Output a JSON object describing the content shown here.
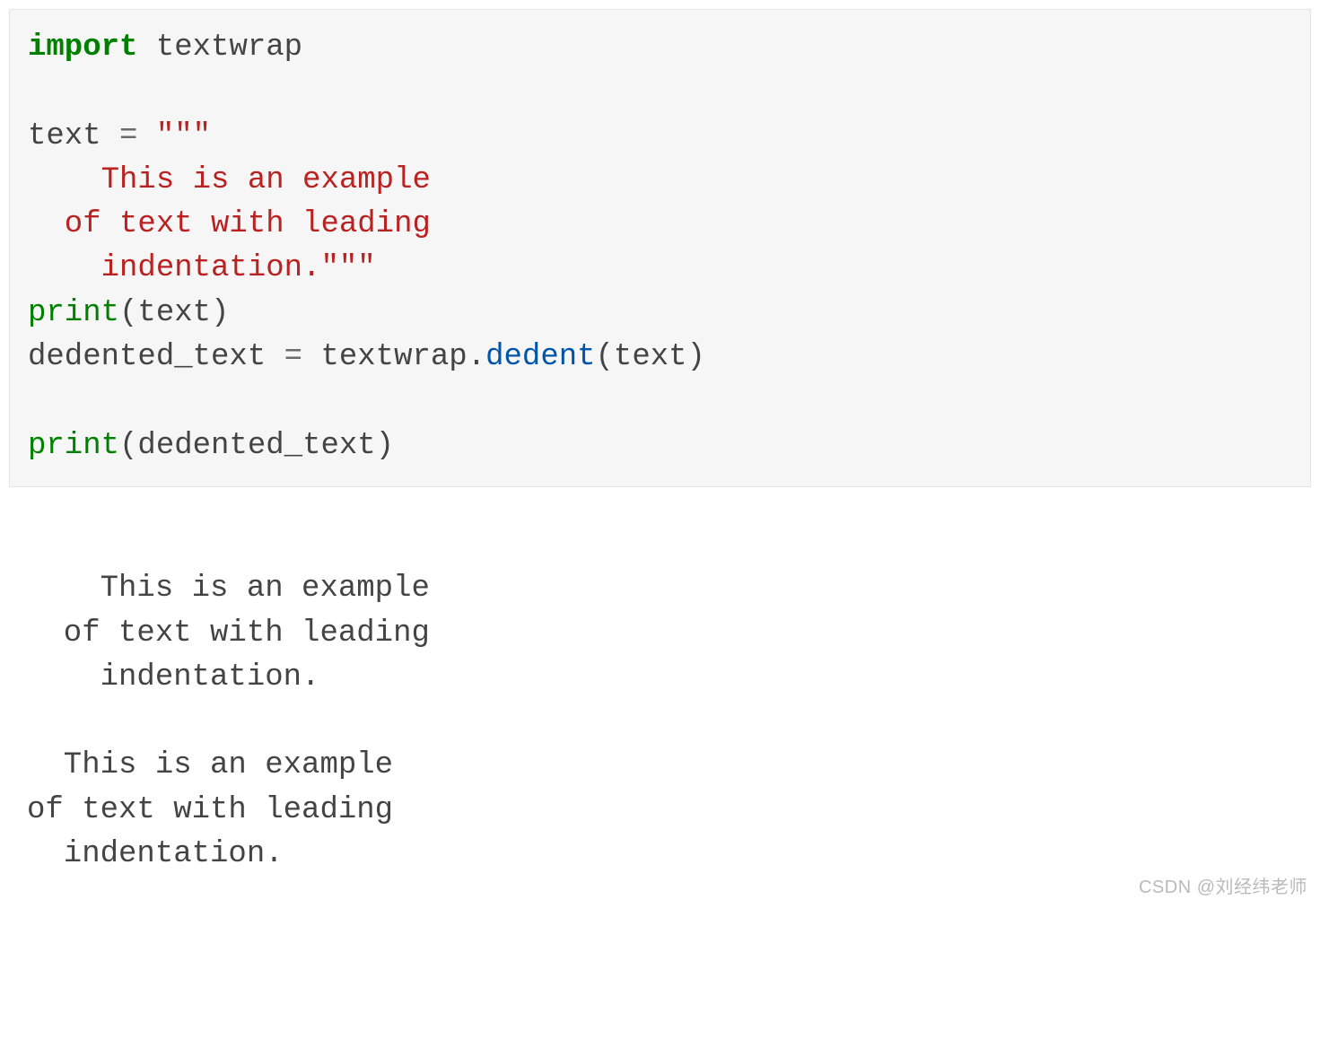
{
  "code": {
    "line1_kw": "import",
    "line1_mod": " textwrap",
    "blank": "",
    "line3_var": "text ",
    "line3_eq": "=",
    "line3_open": " \"\"\"",
    "line4": "    This is an example",
    "line5": "  of text with leading",
    "line6_str": "    indentation.",
    "line6_close": "\"\"\"",
    "line7_fn": "print",
    "line7_rest": "(text)",
    "line8_lhs": "dedented_text ",
    "line8_eq": "=",
    "line8_mid": " textwrap",
    "line8_dot": ".",
    "line8_meth": "dedent",
    "line8_rest": "(text)",
    "line10_fn": "print",
    "line10_rest": "(dedented_text)"
  },
  "output": {
    "block1_l1": "    This is an example",
    "block1_l2": "  of text with leading",
    "block1_l3": "    indentation.",
    "block2_l1": "  This is an example",
    "block2_l2": "of text with leading",
    "block2_l3": "  indentation."
  },
  "watermark": "CSDN @刘经纬老师"
}
